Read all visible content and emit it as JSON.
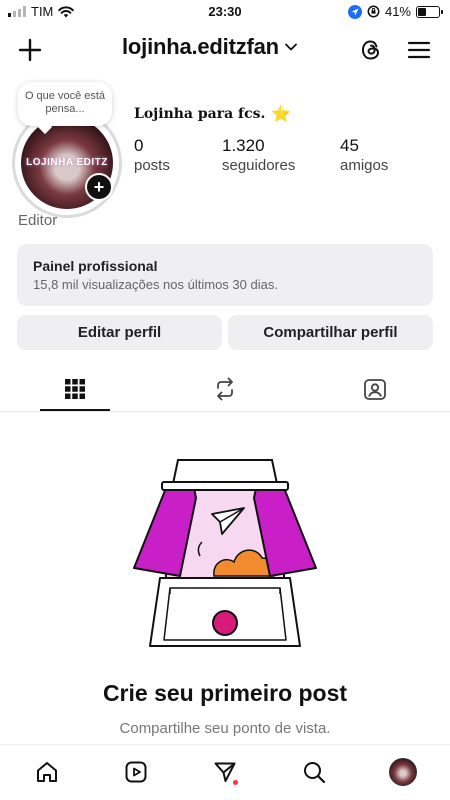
{
  "status_bar": {
    "carrier": "TIM",
    "time": "23:30",
    "battery": "41%",
    "battery_level": 0.41,
    "signal_bars_active": 1
  },
  "header": {
    "username": "lojinha.editzfan",
    "icons": [
      "plus-icon",
      "chevron-down-icon",
      "threads-icon",
      "menu-icon"
    ]
  },
  "profile": {
    "note_bubble": "O que você está pensa...",
    "avatar_text": "LOJINHA EDITZ",
    "display_name": "Lojinha para fcs.",
    "display_name_emoji": "⭐",
    "category": "Editor",
    "stats": [
      {
        "value": "0",
        "label": "posts"
      },
      {
        "value": "1.320",
        "label": "seguidores"
      },
      {
        "value": "45",
        "label": "amigos"
      }
    ]
  },
  "professional_panel": {
    "title": "Painel profissional",
    "subtitle": "15,8 mil visualizações nos últimos 30 dias."
  },
  "actions": {
    "edit_profile": "Editar perfil",
    "share_profile": "Compartilhar perfil"
  },
  "tabs": [
    {
      "name": "grid",
      "icon": "grid-icon",
      "active": true
    },
    {
      "name": "reels",
      "icon": "repost-icon",
      "active": false
    },
    {
      "name": "tagged",
      "icon": "tagged-icon",
      "active": false
    }
  ],
  "empty_state": {
    "title": "Crie seu primeiro post",
    "subtitle": "Compartilhe seu ponto de vista."
  },
  "bottom_nav": [
    "home-icon",
    "reels-icon",
    "direct-icon",
    "search-icon",
    "profile-avatar"
  ],
  "colors": {
    "accent_magenta": "#c81fc6",
    "accent_orange": "#f28a2e",
    "notification_red": "#ff3040",
    "button_gray": "#efeff1"
  }
}
